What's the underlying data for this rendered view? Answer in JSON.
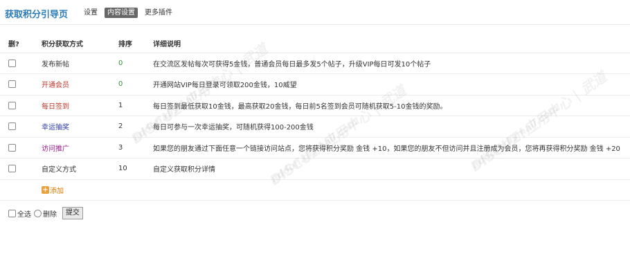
{
  "header": {
    "title": "获取积分引导页",
    "tabs": [
      {
        "label": "设置",
        "active": false
      },
      {
        "label": "内容设置",
        "active": true
      },
      {
        "label": "更多插件",
        "active": false
      }
    ]
  },
  "table": {
    "columns": [
      "删?",
      "积分获取方式",
      "排序",
      "详细说明"
    ],
    "rows": [
      {
        "name": "发布新帖",
        "color": "#333333",
        "order": "0",
        "order_color": "#3a8f3a",
        "desc": "在交流区发帖每次可获得5金钱，普通会员每日最多发5个帖子，升级VIP每日可发10个帖子"
      },
      {
        "name": "开通会员",
        "color": "#c0392b",
        "order": "0",
        "order_color": "#3a8f3a",
        "desc": "开通网站VIP每日登录可领取200金钱，10威望"
      },
      {
        "name": "每日签到",
        "color": "#c0392b",
        "order": "1",
        "order_color": "#333333",
        "desc": "每日签到最低获取10金钱，最高获取20金钱，每日前5名签到会员可随机获取5-10金钱的奖励。"
      },
      {
        "name": "幸运抽奖",
        "color": "#2b3aa8",
        "order": "2",
        "order_color": "#333333",
        "desc": "每日可参与一次幸运抽奖，可随机获得100-200金钱"
      },
      {
        "name": "访问推广",
        "color": "#a1228f",
        "order": "3",
        "order_color": "#333333",
        "desc": "如果您的朋友通过下面任意一个链接访问站点，您将获得积分奖励 金钱 +10，如果您的朋友不但访问并且注册成为会员，您将再获得积分奖励 金钱 +20"
      },
      {
        "name": "自定义方式",
        "color": "#333333",
        "order": "10",
        "order_color": "#333333",
        "desc": "自定义获取积分详情"
      }
    ],
    "add_label": "添加"
  },
  "footer": {
    "select_all": "全选",
    "delete": "删除",
    "submit": "提交"
  },
  "watermark": {
    "text1": "DISCUZ!应用中心 | 武道",
    "text2": "addon.dismall.com"
  }
}
